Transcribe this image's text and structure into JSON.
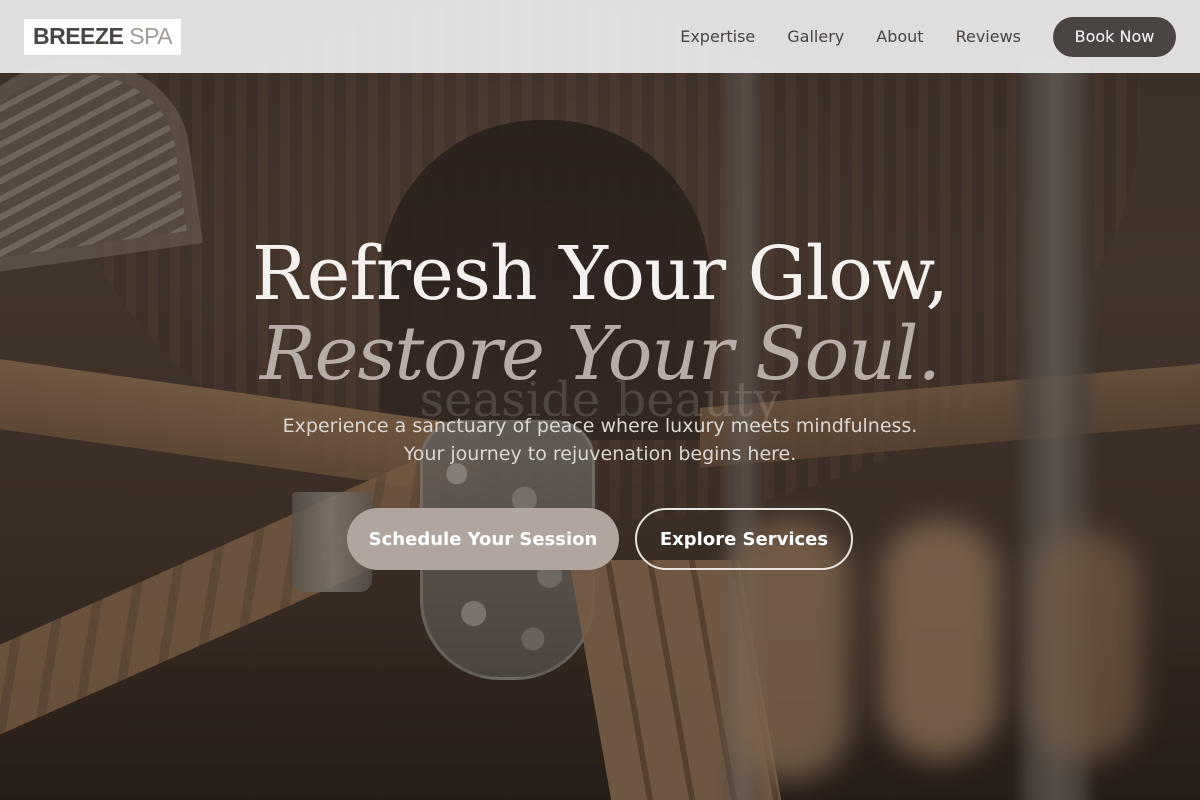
{
  "brand": {
    "name_part1": "BREEZE",
    "name_part2": "SPA"
  },
  "nav": {
    "links": [
      "Expertise",
      "Gallery",
      "About",
      "Reviews"
    ],
    "cta_label": "Book Now"
  },
  "hero": {
    "headline_line1": "Refresh Your Glow,",
    "headline_line2": "Restore Your Soul.",
    "watermark_text": "seaside beauty",
    "subtext_line1": "Experience a sanctuary of peace where luxury meets mindfulness.",
    "subtext_line2": "Your journey to rejuvenation begins here.",
    "primary_cta": "Schedule Your Session",
    "secondary_cta": "Explore Services"
  },
  "colors": {
    "nav_background": "#ececec",
    "brand_dark": "#4a4442",
    "brand_muted": "#a39a95",
    "primary_button": "#b0a69f",
    "headline_light": "#f4f1ee",
    "headline_italic": "#b7ada6"
  }
}
